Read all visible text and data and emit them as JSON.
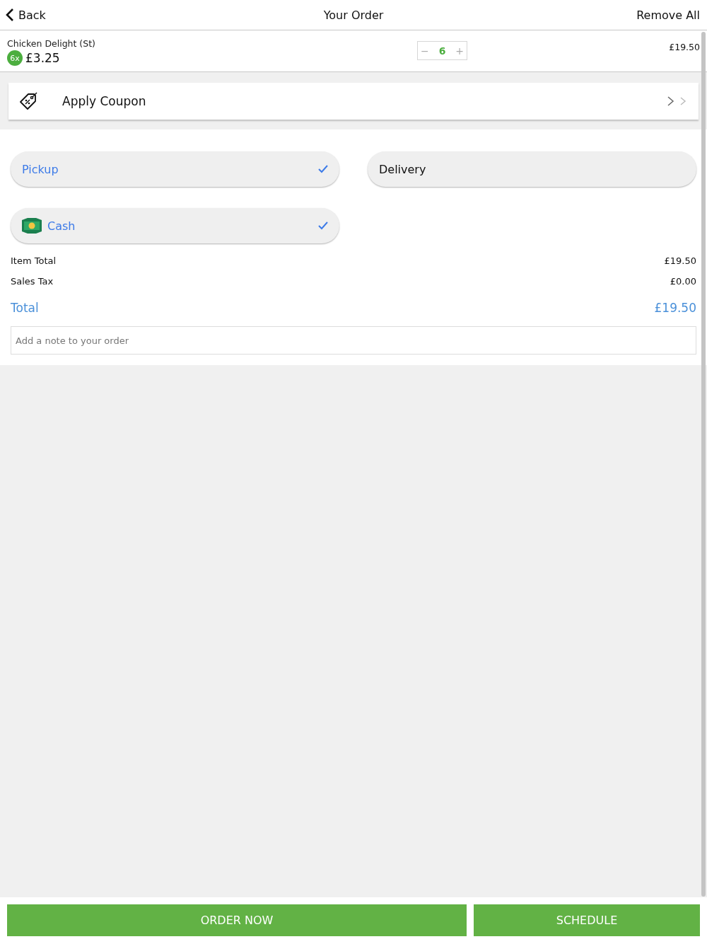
{
  "header": {
    "back": "Back",
    "title": "Your Order",
    "action": "Remove All"
  },
  "items": [
    {
      "name": "Chicken Delight (St)",
      "badge": "6x",
      "unit_price": "£3.25",
      "quantity": "6",
      "minus": "−",
      "plus": "+",
      "line_total": "£19.50"
    }
  ],
  "coupon": {
    "label": "Apply Coupon"
  },
  "order_types": [
    {
      "label": "Pickup",
      "selected": true
    },
    {
      "label": "Delivery",
      "selected": false
    }
  ],
  "payment_methods": [
    {
      "label": "Cash",
      "selected": true
    }
  ],
  "summary": [
    {
      "kind": "line",
      "label": "Item Total",
      "value": "£19.50"
    },
    {
      "kind": "line",
      "label": "Sales Tax",
      "value": "£0.00"
    },
    {
      "kind": "total",
      "label": "Total",
      "value": "£19.50"
    }
  ],
  "note": {
    "placeholder": "Add a note to your order"
  },
  "buttons": [
    "ORDER NOW",
    "SCHEDULE"
  ]
}
